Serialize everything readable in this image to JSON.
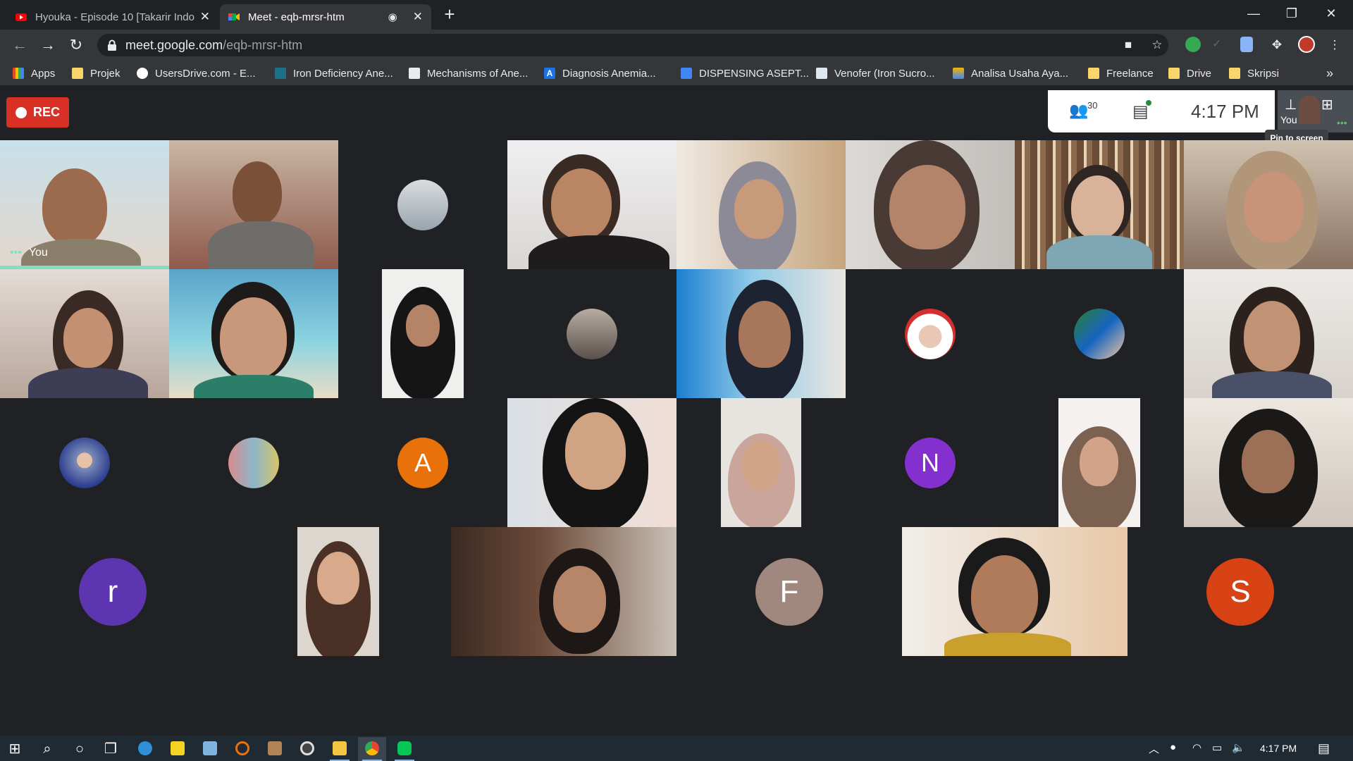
{
  "tabs": [
    {
      "title": "Hyouka - Episode 10 [Takarir Indo",
      "icon": "youtube-icon",
      "active": false
    },
    {
      "title": "Meet - eqb-mrsr-htm",
      "icon": "meet-icon",
      "active": true
    }
  ],
  "window": {
    "minimize": "—",
    "restore": "❐",
    "close": "✕"
  },
  "address": {
    "host": "meet.google.com",
    "path": "/eqb-mrsr-htm"
  },
  "bookmarks": [
    "Apps",
    "Projek",
    "UsersDrive.com - E...",
    "Iron Deficiency Ane...",
    "Mechanisms of Ane...",
    "Diagnosis Anemia...",
    "DISPENSING ASEPT...",
    "Venofer (Iron Sucro...",
    "Analisa Usaha Aya...",
    "Freelance",
    "Drive",
    "Skripsi"
  ],
  "bookmark_overflow": "»",
  "meet": {
    "rec_label": "REC",
    "participants_count": "30",
    "time": "4:17 PM",
    "you_label": "You",
    "self_corner_label": "You",
    "pin_tooltip": "Pin to screen",
    "letters": {
      "a": "A",
      "n": "N",
      "r": "r",
      "f": "F",
      "s": "S"
    },
    "avatar_colors": {
      "a": "#e8710a",
      "n": "#8430ce",
      "r": "#5e35b1",
      "f": "#a1887f",
      "s": "#d84315"
    }
  },
  "taskbar": {
    "clock": "4:17 PM"
  }
}
